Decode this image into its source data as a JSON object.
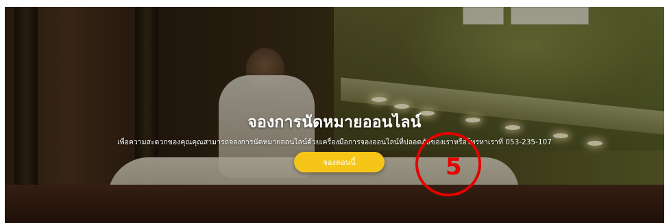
{
  "hero": {
    "title": "จองการนัดหมายออนไลน์",
    "subtitle": "เพื่อความสะดวกของคุณคุณสามารถจองการนัดหมายออนไลน์ด้วยเครื่องมือการจองออนไลน์ที่ปลอดภัยของเราหรือโทรหาเราที่ 053-235-107",
    "cta_label": "จองตอนนี้",
    "accent_color": "#f5c518"
  },
  "annotation": {
    "label": "5",
    "color": "#e60000"
  }
}
